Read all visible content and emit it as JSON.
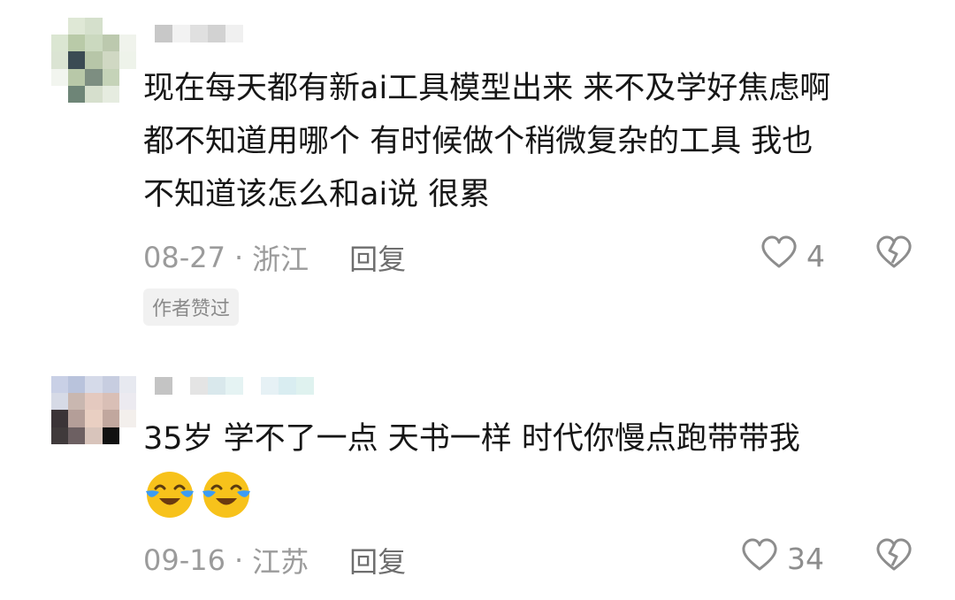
{
  "comments": [
    {
      "text": "现在每天都有新ai工具模型出来 来不及学好焦虑啊\n都不知道用哪个 有时候做个稍微复杂的工具 我也\n不知道该怎么和ai说 很累",
      "date": "08-27",
      "separator": "·",
      "region": "浙江",
      "reply_label": "回复",
      "likes": "4",
      "badge": "作者赞过",
      "icons": [
        "heart-outline-icon",
        "broken-heart-icon"
      ]
    },
    {
      "text": "35岁 学不了一点 天书一样 时代你慢点跑带带我",
      "date": "09-16",
      "separator": "·",
      "region": "江苏",
      "reply_label": "回复",
      "likes": "34",
      "emojis": [
        "crying-laughing-emoji",
        "crying-laughing-emoji"
      ],
      "icons": [
        "heart-outline-icon",
        "broken-heart-icon"
      ]
    }
  ],
  "colors": {
    "text": "#161616",
    "meta": "#9b9b9b",
    "badge_bg": "#f1f1f1",
    "emoji_yellow": "#f7c21b",
    "emoji_tear": "#3b9cf5"
  }
}
